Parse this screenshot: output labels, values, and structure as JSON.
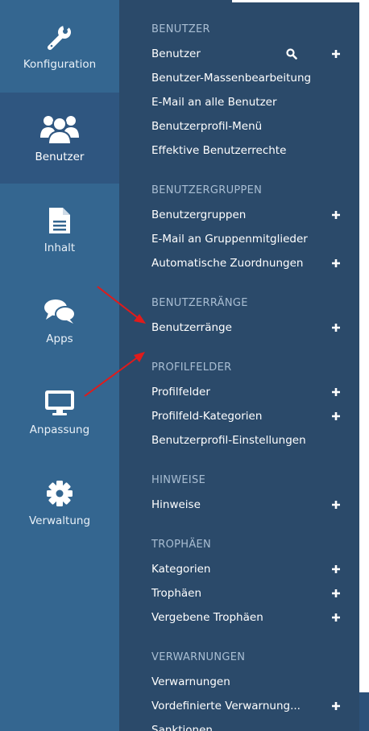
{
  "rail": [
    {
      "label": "Konfiguration",
      "icon": "wrench-icon",
      "active": false
    },
    {
      "label": "Benutzer",
      "icon": "users-icon",
      "active": true
    },
    {
      "label": "Inhalt",
      "icon": "document-icon",
      "active": false
    },
    {
      "label": "Apps",
      "icon": "chat-bubbles-icon",
      "active": false
    },
    {
      "label": "Anpassung",
      "icon": "monitor-icon",
      "active": false
    },
    {
      "label": "Verwaltung",
      "icon": "gear-icon",
      "active": false
    }
  ],
  "sections": [
    {
      "title": "BENUTZER",
      "items": [
        {
          "label": "Benutzer",
          "search": true,
          "plus": true
        },
        {
          "label": "Benutzer-Massenbearbeitung",
          "plus": false
        },
        {
          "label": "E-Mail an alle Benutzer",
          "plus": false
        },
        {
          "label": "Benutzerprofil-Menü",
          "plus": false
        },
        {
          "label": "Effektive Benutzerrechte",
          "plus": false
        }
      ]
    },
    {
      "title": "BENUTZERGRUPPEN",
      "items": [
        {
          "label": "Benutzergruppen",
          "plus": true
        },
        {
          "label": "E-Mail an Gruppenmitglieder",
          "plus": false
        },
        {
          "label": "Automatische Zuordnungen",
          "plus": true
        }
      ]
    },
    {
      "title": "BENUTZERRÄNGE",
      "items": [
        {
          "label": "Benutzerränge",
          "plus": true
        }
      ]
    },
    {
      "title": "PROFILFELDER",
      "items": [
        {
          "label": "Profilfelder",
          "plus": true
        },
        {
          "label": "Profilfeld-Kategorien",
          "plus": true
        },
        {
          "label": "Benutzerprofil-Einstellungen",
          "plus": false
        }
      ]
    },
    {
      "title": "HINWEISE",
      "items": [
        {
          "label": "Hinweise",
          "plus": true
        }
      ]
    },
    {
      "title": "TROPHÄEN",
      "items": [
        {
          "label": "Kategorien",
          "plus": true
        },
        {
          "label": "Trophäen",
          "plus": true
        },
        {
          "label": "Vergebene Trophäen",
          "plus": true
        }
      ]
    },
    {
      "title": "VERWARNUNGEN",
      "items": [
        {
          "label": "Verwarnungen",
          "plus": false
        },
        {
          "label": "Vordefinierte Verwarnung...",
          "plus": true
        },
        {
          "label": "Sanktionen",
          "plus": false
        }
      ]
    }
  ],
  "colors": {
    "annotation_arrow": "#e01b1b"
  }
}
